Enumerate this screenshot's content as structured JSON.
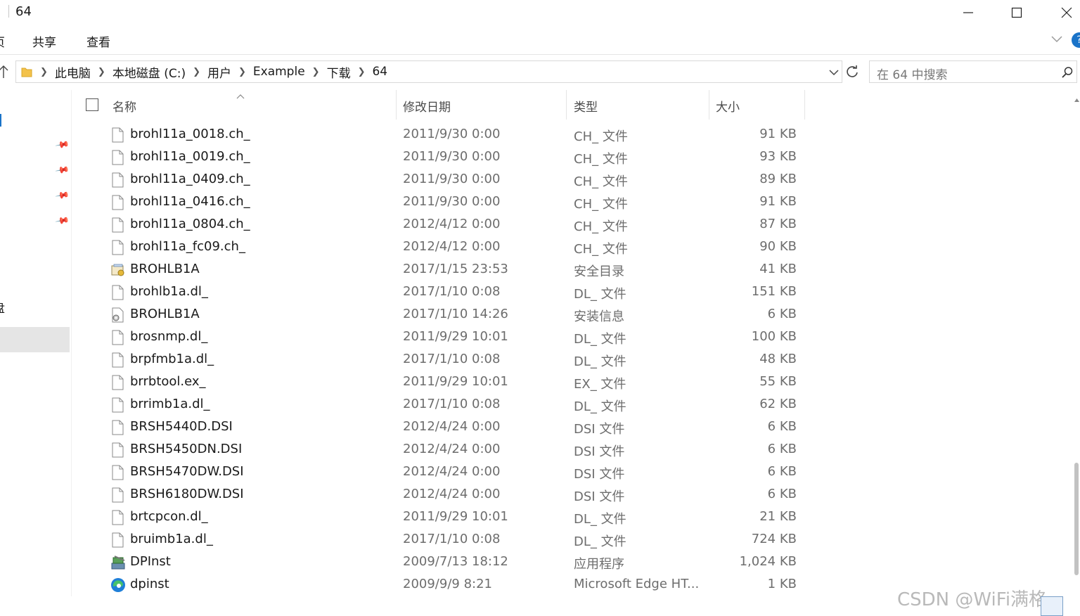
{
  "window": {
    "title": "64",
    "min": "—",
    "max": "☐",
    "close": "✕"
  },
  "ribbon": {
    "left_fragment": "页",
    "tabs": [
      "共享",
      "查看"
    ]
  },
  "address": {
    "crumbs": [
      "此电脑",
      "本地磁盘 (C:)",
      "用户",
      "Example",
      "下载",
      "64"
    ]
  },
  "search": {
    "placeholder": "在 64 中搜索"
  },
  "nav": {
    "left_fragment": "盘"
  },
  "columns": {
    "name": "名称",
    "date": "修改日期",
    "type": "类型",
    "size": "大小"
  },
  "files": [
    {
      "name": "brohl11a_0018.ch_",
      "date": "2011/9/30 0:00",
      "type": "CH_ 文件",
      "size": "91 KB",
      "icon": "file-icon"
    },
    {
      "name": "brohl11a_0019.ch_",
      "date": "2011/9/30 0:00",
      "type": "CH_ 文件",
      "size": "93 KB",
      "icon": "file-icon"
    },
    {
      "name": "brohl11a_0409.ch_",
      "date": "2011/9/30 0:00",
      "type": "CH_ 文件",
      "size": "89 KB",
      "icon": "file-icon"
    },
    {
      "name": "brohl11a_0416.ch_",
      "date": "2011/9/30 0:00",
      "type": "CH_ 文件",
      "size": "91 KB",
      "icon": "file-icon"
    },
    {
      "name": "brohl11a_0804.ch_",
      "date": "2012/4/12 0:00",
      "type": "CH_ 文件",
      "size": "87 KB",
      "icon": "file-icon"
    },
    {
      "name": "brohl11a_fc09.ch_",
      "date": "2012/4/12 0:00",
      "type": "CH_ 文件",
      "size": "90 KB",
      "icon": "file-icon"
    },
    {
      "name": "BROHLB1A",
      "date": "2017/1/15 23:53",
      "type": "安全目录",
      "size": "41 KB",
      "icon": "security-catalog-icon"
    },
    {
      "name": "brohlb1a.dl_",
      "date": "2017/1/10 0:08",
      "type": "DL_ 文件",
      "size": "151 KB",
      "icon": "file-icon"
    },
    {
      "name": "BROHLB1A",
      "date": "2017/1/10 14:26",
      "type": "安装信息",
      "size": "6 KB",
      "icon": "setup-info-icon"
    },
    {
      "name": "brosnmp.dl_",
      "date": "2011/9/29 10:01",
      "type": "DL_ 文件",
      "size": "100 KB",
      "icon": "file-icon"
    },
    {
      "name": "brpfmb1a.dl_",
      "date": "2017/1/10 0:08",
      "type": "DL_ 文件",
      "size": "48 KB",
      "icon": "file-icon"
    },
    {
      "name": "brrbtool.ex_",
      "date": "2011/9/29 10:01",
      "type": "EX_ 文件",
      "size": "55 KB",
      "icon": "file-icon"
    },
    {
      "name": "brrimb1a.dl_",
      "date": "2017/1/10 0:08",
      "type": "DL_ 文件",
      "size": "62 KB",
      "icon": "file-icon"
    },
    {
      "name": "BRSH5440D.DSI",
      "date": "2012/4/24 0:00",
      "type": "DSI 文件",
      "size": "6 KB",
      "icon": "file-icon"
    },
    {
      "name": "BRSH5450DN.DSI",
      "date": "2012/4/24 0:00",
      "type": "DSI 文件",
      "size": "6 KB",
      "icon": "file-icon"
    },
    {
      "name": "BRSH5470DW.DSI",
      "date": "2012/4/24 0:00",
      "type": "DSI 文件",
      "size": "6 KB",
      "icon": "file-icon"
    },
    {
      "name": "BRSH6180DW.DSI",
      "date": "2012/4/24 0:00",
      "type": "DSI 文件",
      "size": "6 KB",
      "icon": "file-icon"
    },
    {
      "name": "brtcpcon.dl_",
      "date": "2011/9/29 10:01",
      "type": "DL_ 文件",
      "size": "21 KB",
      "icon": "file-icon"
    },
    {
      "name": "bruimb1a.dl_",
      "date": "2017/1/10 0:08",
      "type": "DL_ 文件",
      "size": "724 KB",
      "icon": "file-icon"
    },
    {
      "name": "DPInst",
      "date": "2009/7/13 18:12",
      "type": "应用程序",
      "size": "1,024 KB",
      "icon": "installer-app-icon"
    },
    {
      "name": "dpinst",
      "date": "2009/9/9 8:21",
      "type": "Microsoft Edge HT...",
      "size": "1 KB",
      "icon": "edge-icon"
    }
  ],
  "watermark": "CSDN @WiFi满格"
}
